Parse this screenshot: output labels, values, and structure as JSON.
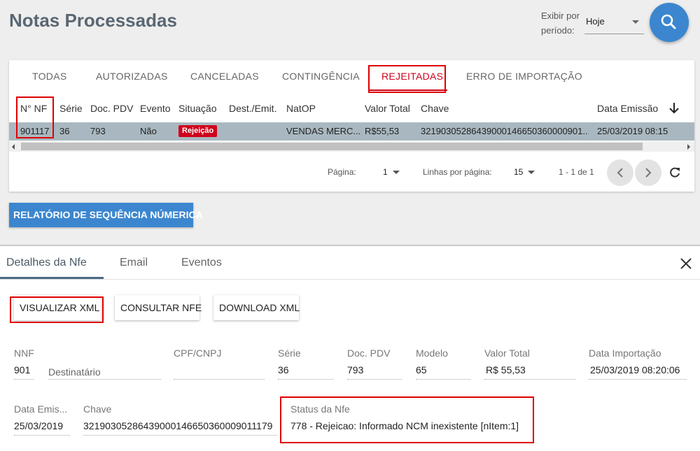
{
  "header": {
    "title": "Notas Processadas",
    "period_label": "Exibir por período:",
    "period_value": "Hoje"
  },
  "tabs": [
    "TODAS",
    "AUTORIZADAS",
    "CANCELADAS",
    "CONTINGÊNCIA",
    "REJEITADAS",
    "ERRO DE IMPORTAÇÃO"
  ],
  "active_tab": "REJEITADAS",
  "table": {
    "columns": [
      "N° NF",
      "Série",
      "Doc. PDV",
      "Evento",
      "Situação",
      "Dest./Emit.",
      "NatOP",
      "Valor Total",
      "Chave",
      "Data Emissão"
    ],
    "rows": [
      {
        "nnf": "901117",
        "serie": "36",
        "doc_pdv": "793",
        "evento": "Não",
        "situacao": "Rejeição",
        "dest_emit": "",
        "natop": "VENDAS MERC...",
        "valor_total": "R$55,53",
        "chave": "32190305286439000146650360000901...",
        "data_emissao": "25/03/2019 08:15"
      }
    ]
  },
  "pagination": {
    "page_label": "Página:",
    "page": "1",
    "rows_label": "Linhas por página:",
    "rows": "15",
    "range": "1 - 1 de 1"
  },
  "report_button": "RELATÓRIO DE SEQUÊNCIA NÚMERICA",
  "details": {
    "tabs": [
      "Detalhes da Nfe",
      "Email",
      "Eventos"
    ],
    "actions": [
      "VISUALIZAR XML",
      "CONSULTAR NFE",
      "DOWNLOAD XML"
    ],
    "fields": {
      "nnf_label": "NNF",
      "nnf_value": "901",
      "destinatario_label": "Destinatário",
      "cpf_label": "CPF/CNPJ",
      "cpf_value": "",
      "serie_label": "Série",
      "serie_value": "36",
      "docpdv_label": "Doc. PDV",
      "docpdv_value": "793",
      "modelo_label": "Modelo",
      "modelo_value": "65",
      "valor_label": "Valor Total",
      "valor_value": "R$ 55,53",
      "dataimp_label": "Data Importação",
      "dataimp_value": "25/03/2019 08:20:06",
      "dataemis_label": "Data Emis...",
      "dataemis_value": "25/03/2019",
      "chave_label": "Chave",
      "chave_value": "32190305286439000146650360009011179",
      "status_label": "Status da Nfe",
      "status_value": "778 - Rejeicao: Informado NCM inexistente [nItem:1]"
    }
  },
  "colors": {
    "accent_blue": "#3b86cf",
    "reject_red": "#d0021b",
    "row_selected": "#a9b8c0"
  }
}
